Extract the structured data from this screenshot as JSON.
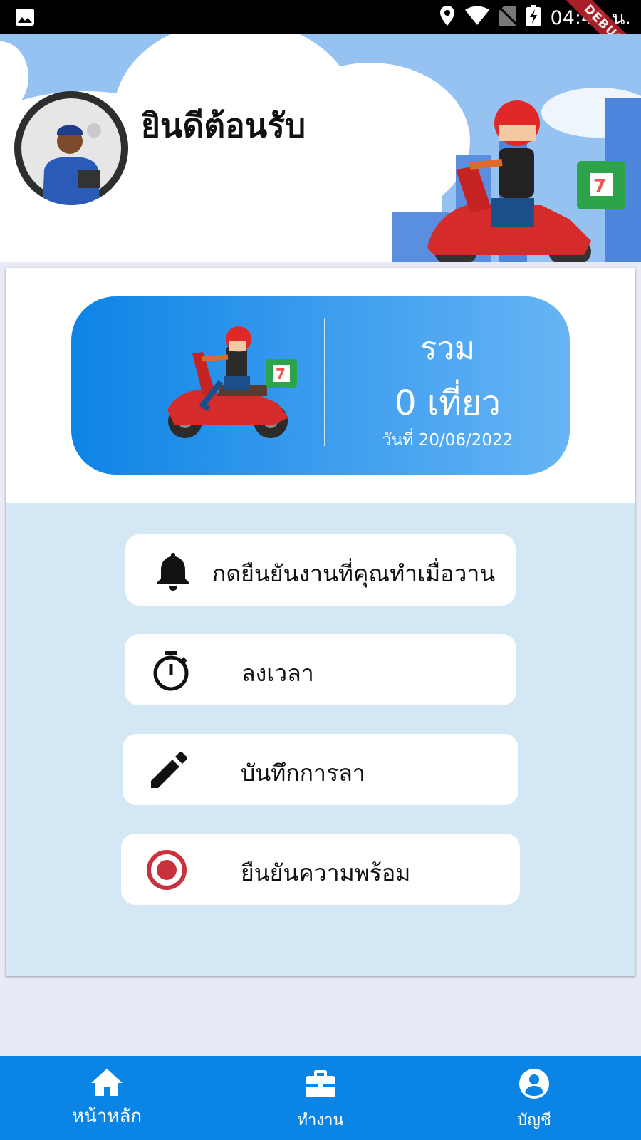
{
  "status_bar": {
    "time": "04:40 น.",
    "debug_banner": "DEBUG"
  },
  "header": {
    "welcome": "ยินดีต้อนรับ"
  },
  "summary": {
    "total_label": "รวม",
    "trips": "0 เที่ยว",
    "date": "วันที่ 20/06/2022"
  },
  "menu": [
    {
      "label": "กดยืนยันงานที่คุณทำเมื่อวาน",
      "icon": "bell-icon"
    },
    {
      "label": "ลงเวลา",
      "icon": "stopwatch-icon"
    },
    {
      "label": "บันทึกการลา",
      "icon": "pencil-icon"
    },
    {
      "label": "ยืนยันความพร้อม",
      "icon": "radio-target-icon"
    }
  ],
  "bottom_nav": [
    {
      "label": "หน้าหลัก",
      "icon": "home-icon",
      "active": true
    },
    {
      "label": "ทำงาน",
      "icon": "briefcase-icon",
      "active": false
    },
    {
      "label": "บัญชี",
      "icon": "account-circle-icon",
      "active": false
    }
  ],
  "colors": {
    "primary": "#0a84e5",
    "card_bg": "#d3e7f5",
    "accent_red": "#c8323c"
  }
}
